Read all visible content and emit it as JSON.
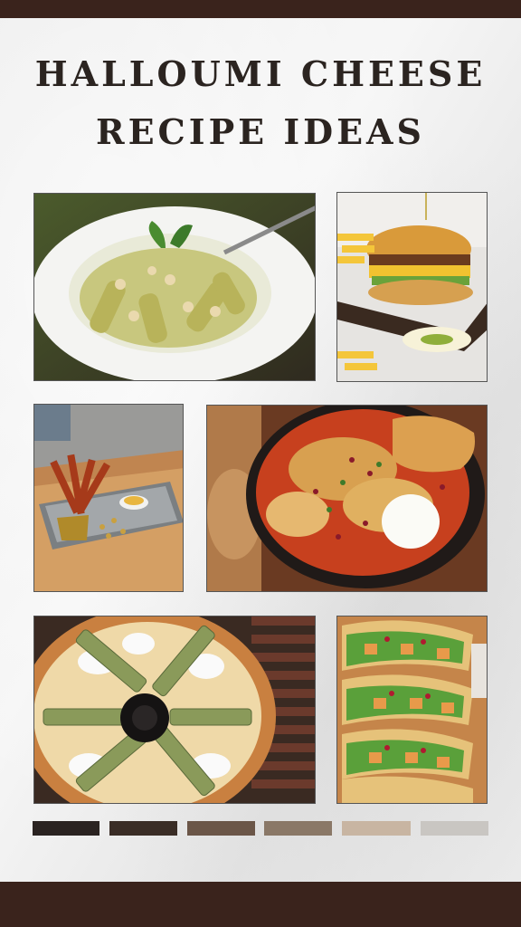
{
  "title": {
    "line1": "HALLOUMI CHEESE",
    "line2": "RECIPE IDEAS"
  },
  "photos": [
    {
      "name": "halloumi-pasta-photo"
    },
    {
      "name": "halloumi-burger-photo"
    },
    {
      "name": "halloumi-fries-photo"
    },
    {
      "name": "halloumi-shakshuka-photo"
    },
    {
      "name": "halloumi-pizza-photo"
    },
    {
      "name": "halloumi-tacos-photo"
    }
  ],
  "palette": [
    "#2a2321",
    "#3a2d26",
    "#6b5648",
    "#8a7867",
    "#c8b5a2",
    "#c9c6c2"
  ]
}
